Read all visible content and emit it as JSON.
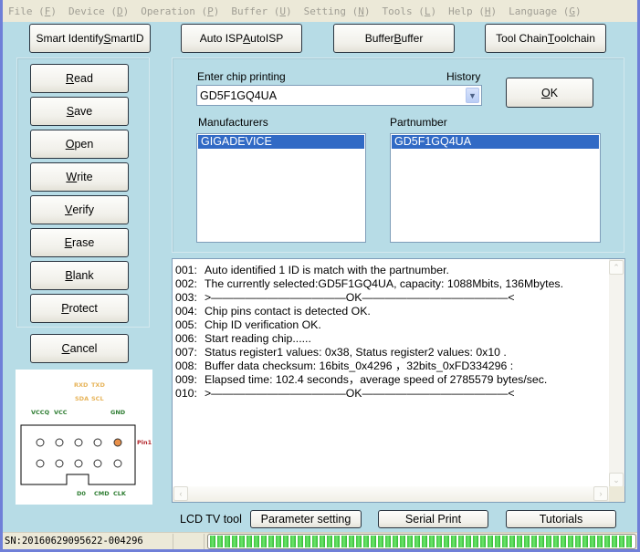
{
  "menubar": {
    "items": [
      {
        "label": "File",
        "hotkey": "F"
      },
      {
        "label": "Device",
        "hotkey": "D"
      },
      {
        "label": "Operation",
        "hotkey": "P"
      },
      {
        "label": "Buffer",
        "hotkey": "U"
      },
      {
        "label": "Setting",
        "hotkey": "N"
      },
      {
        "label": "Tools",
        "hotkey": "L"
      },
      {
        "label": "Help",
        "hotkey": "H"
      },
      {
        "label": "Language",
        "hotkey": "G"
      }
    ]
  },
  "toolbar": {
    "smart_id": {
      "pre": "Smart Identify ",
      "hot": "S",
      "post": "martID"
    },
    "auto_isp": {
      "pre": "Auto ISP ",
      "hot": "A",
      "post": "utoISP"
    },
    "buffer": {
      "pre": "Buffer ",
      "hot": "B",
      "post": "uffer"
    },
    "toolchain": {
      "pre": "Tool Chain ",
      "hot": "T",
      "post": "oolchain"
    }
  },
  "operations": {
    "read": {
      "hot": "R",
      "post": "ead"
    },
    "save": {
      "hot": "S",
      "post": "ave"
    },
    "open": {
      "hot": "O",
      "post": "pen"
    },
    "write": {
      "hot": "W",
      "post": "rite"
    },
    "verify": {
      "hot": "V",
      "post": "erify"
    },
    "erase": {
      "hot": "E",
      "post": "rase"
    },
    "blank": {
      "hot": "B",
      "post": "lank"
    },
    "protect": {
      "hot": "P",
      "post": "rotect"
    },
    "cancel": {
      "hot": "C",
      "post": "ancel"
    }
  },
  "pinout": {
    "top_labels": {
      "rxd": "RXD",
      "txd": "TXD",
      "sda": "SDA",
      "scl": "SCL"
    },
    "upper_labels": {
      "vccq": "VCCQ",
      "vcc": "VCC",
      "gnd": "GND"
    },
    "pin1": "Pin1",
    "lower_labels": {
      "d0": "D0",
      "cmd": "CMD",
      "clk": "CLK"
    }
  },
  "chip": {
    "enter_label": "Enter chip printing",
    "history_label": "History",
    "value": "GD5F1GQ4UA",
    "ok": {
      "hot": "O",
      "post": "K"
    }
  },
  "manufacturers": {
    "label": "Manufacturers",
    "items": [
      "GIGADEVICE"
    ],
    "selected": "GIGADEVICE"
  },
  "partnumber": {
    "label": "Partnumber",
    "items": [
      "GD5F1GQ4UA"
    ],
    "selected": "GD5F1GQ4UA"
  },
  "log": [
    {
      "num": "001:",
      "text": "Auto identified 1 ID is match with the partnumber."
    },
    {
      "num": "002:",
      "text": "The currently selected:GD5F1GQ4UA, capacity: 1088Mbits, 136Mbytes."
    },
    {
      "num": "003:",
      "text": ">————————————OK—————————————<"
    },
    {
      "num": "004:",
      "text": "Chip pins contact is detected OK."
    },
    {
      "num": "005:",
      "text": "Chip ID verification OK."
    },
    {
      "num": "006:",
      "text": "Start reading chip......"
    },
    {
      "num": "007:",
      "text": "Status register1 values: 0x38, Status register2 values: 0x10 ."
    },
    {
      "num": "008:",
      "text": "Buffer data checksum: 16bits_0x4296 ，32bits_0xFD334296 :"
    },
    {
      "num": "009:",
      "text": "Elapsed time: 102.4 seconds，average speed of 2785579 bytes/sec."
    },
    {
      "num": "010:",
      "text": ">————————————OK—————————————<"
    }
  ],
  "tools": {
    "lcd_label": "LCD TV tool",
    "parameter_setting": "Parameter setting",
    "serial_print": "Serial Print",
    "tutorials": "Tutorials"
  },
  "status": {
    "sn": "SN:20160629095622-004296",
    "progress_percent": 100
  }
}
